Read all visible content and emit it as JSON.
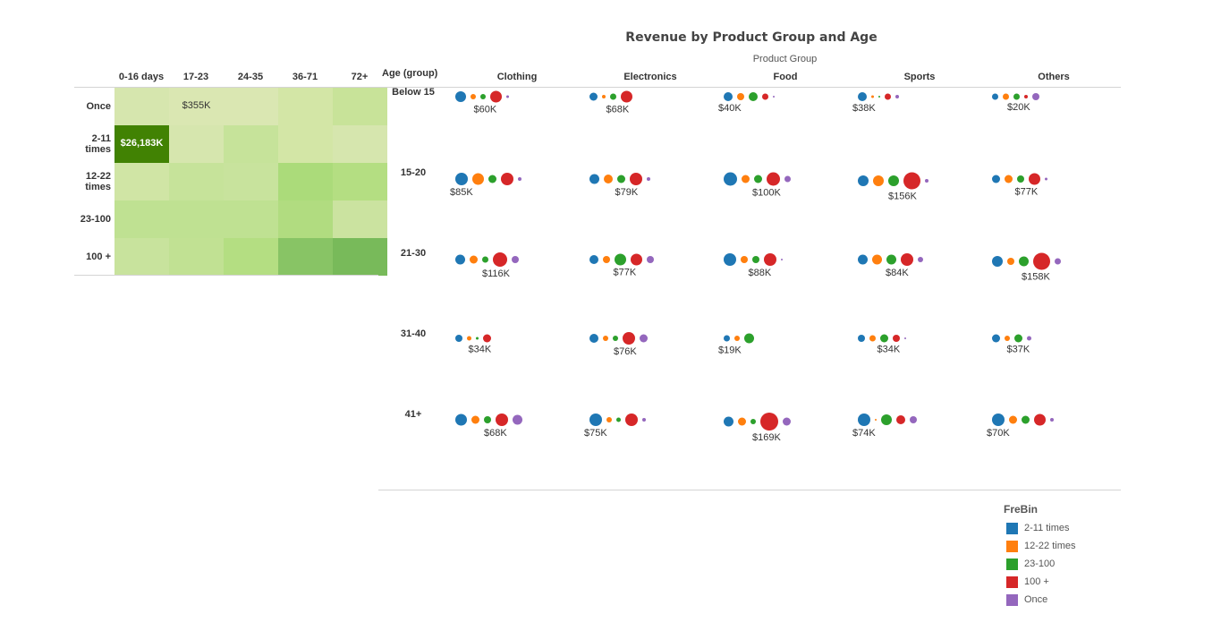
{
  "heatmap": {
    "columns": [
      "0-16 days",
      "17-23",
      "24-35",
      "36-71",
      "72+"
    ],
    "rows": [
      "Once",
      "2-11\ntimes",
      "12-22\ntimes",
      "23-100",
      "100 +"
    ],
    "cell_colors": [
      [
        "#d6e6ae",
        "#dae7b2",
        "#dae7b2",
        "#d3e6a6",
        "#c8e399"
      ],
      [
        "#418203",
        "#d6e6ae",
        "#c6e39a",
        "#d3e6a6",
        "#d6e6ae"
      ],
      [
        "#d0e5a5",
        "#c6e39a",
        "#c8e39d",
        "#abdb7a",
        "#b4de82"
      ],
      [
        "#bfe192",
        "#bfe192",
        "#bfe192",
        "#b1dc80",
        "#cbe3a0"
      ],
      [
        "#c8e39d",
        "#c1e193",
        "#b4de82",
        "#88c465",
        "#78ba5a"
      ]
    ],
    "labels": [
      {
        "row": 0,
        "col": 1,
        "text": "$355K",
        "dark": false
      },
      {
        "row": 1,
        "col": 0,
        "text": "$26,183K",
        "dark": true
      }
    ]
  },
  "chart_data": {
    "type": "scatter",
    "title": "Revenue by Product Group and Age",
    "xlabel": "Product Group",
    "ylabel": "Age (group)",
    "columns": [
      "Clothing",
      "Electronics",
      "Food",
      "Sports",
      "Others"
    ],
    "rows": [
      "Below 15",
      "15-20",
      "21-30",
      "31-40",
      "41+"
    ],
    "series_order": [
      "2-11 times",
      "12-22 times",
      "23-100",
      "100 +",
      "Once"
    ],
    "note": "sizes are relative bubble magnitudes (estimated) per FreBin series; totals are labeled",
    "cells": [
      [
        {
          "total": "$60K",
          "sizes": [
            6,
            3,
            3,
            6.5,
            1.5
          ]
        },
        {
          "total": "$68K",
          "sizes": [
            4.5,
            2,
            3.5,
            6.5,
            0
          ]
        },
        {
          "total": "$40K",
          "sizes": [
            5,
            4,
            5,
            3.5,
            1
          ]
        },
        {
          "total": "$38K",
          "sizes": [
            5,
            1.5,
            1,
            3.5,
            2
          ]
        },
        {
          "total": "$20K",
          "sizes": [
            3.5,
            3.5,
            3.5,
            2,
            4
          ]
        }
      ],
      [
        {
          "total": "$85K",
          "sizes": [
            7,
            6.5,
            4.5,
            7,
            2
          ]
        },
        {
          "total": "$79K",
          "sizes": [
            5.5,
            5,
            4.5,
            7,
            2
          ]
        },
        {
          "total": "$100K",
          "sizes": [
            7.5,
            4.5,
            4.5,
            7.5,
            3.5
          ]
        },
        {
          "total": "$156K",
          "sizes": [
            6,
            6,
            6,
            9.5,
            2
          ]
        },
        {
          "total": "$77K",
          "sizes": [
            4.5,
            4.5,
            4,
            6.5,
            1.5
          ]
        }
      ],
      [
        {
          "total": "$116K",
          "sizes": [
            5.5,
            4.5,
            3.5,
            8,
            4
          ]
        },
        {
          "total": "$77K",
          "sizes": [
            5,
            4,
            6.5,
            6.5,
            4
          ]
        },
        {
          "total": "$88K",
          "sizes": [
            7,
            4,
            4,
            7,
            1
          ]
        },
        {
          "total": "$84K",
          "sizes": [
            5.5,
            5.5,
            5.5,
            7,
            3
          ]
        },
        {
          "total": "$158K",
          "sizes": [
            6,
            4,
            5.5,
            9.5,
            3.5
          ]
        }
      ],
      [
        {
          "total": "$34K",
          "sizes": [
            4,
            2.5,
            1.5,
            4.5,
            0
          ]
        },
        {
          "total": "$76K",
          "sizes": [
            5,
            3,
            3,
            7,
            4.5
          ]
        },
        {
          "total": "$19K",
          "sizes": [
            3.5,
            3,
            5.5,
            0,
            0
          ]
        },
        {
          "total": "$34K",
          "sizes": [
            4,
            3.5,
            4.5,
            4,
            1
          ]
        },
        {
          "total": "$37K",
          "sizes": [
            4.5,
            3,
            4.5,
            0,
            2.5
          ]
        }
      ],
      [
        {
          "total": "$68K",
          "sizes": [
            6.5,
            4.5,
            4,
            7,
            5.5
          ]
        },
        {
          "total": "$75K",
          "sizes": [
            7,
            3,
            2.5,
            7,
            2
          ]
        },
        {
          "total": "$169K",
          "sizes": [
            5.5,
            4.5,
            3,
            10,
            4.5
          ]
        },
        {
          "total": "$74K",
          "sizes": [
            7,
            1,
            6,
            5,
            4
          ]
        },
        {
          "total": "$70K",
          "sizes": [
            7,
            4.5,
            4.5,
            6.5,
            2
          ]
        }
      ]
    ],
    "label_offsets": [
      [
        0,
        1,
        -2,
        -2,
        0
      ],
      [
        -2,
        1,
        1,
        1,
        1
      ],
      [
        1,
        0,
        1,
        1,
        1
      ],
      [
        1,
        1,
        -2,
        1,
        1
      ],
      [
        1,
        -2,
        1,
        -2,
        -2
      ]
    ]
  },
  "legend": {
    "title": "FreBin",
    "items": [
      {
        "label": "2-11 times",
        "color": "#1f77b4"
      },
      {
        "label": "12-22 times",
        "color": "#ff7f0e"
      },
      {
        "label": "23-100",
        "color": "#2ca02c"
      },
      {
        "label": "100 +",
        "color": "#d62728"
      },
      {
        "label": "Once",
        "color": "#9467bd"
      }
    ]
  }
}
